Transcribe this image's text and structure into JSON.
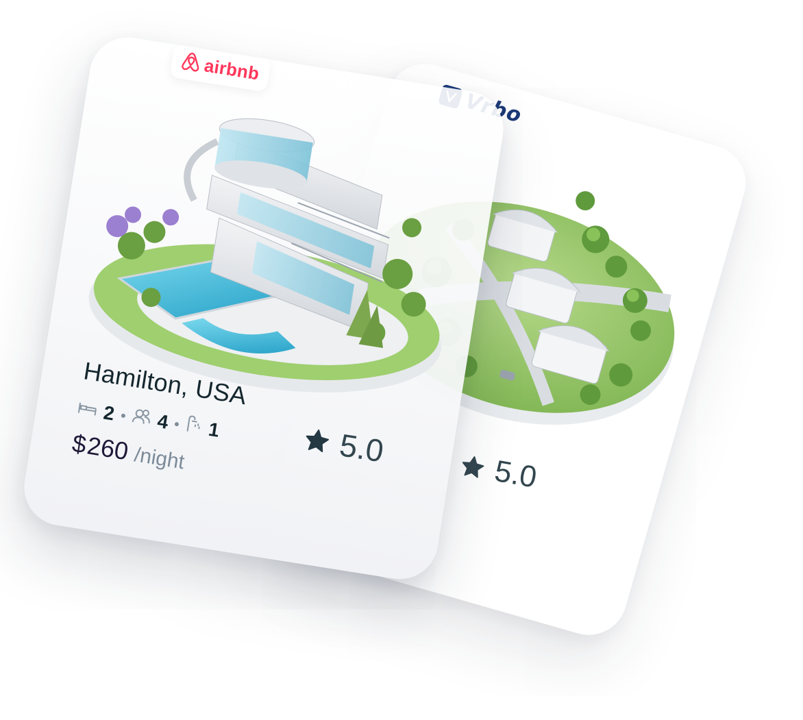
{
  "colors": {
    "airbnb_brand": "#ff385c",
    "vrbo_brand": "#1c3a78",
    "text_dark": "#15272e",
    "text_muted": "#7c8b99",
    "price": "#1f1838",
    "pool": "#3fb6d6",
    "grass": "#8cc260"
  },
  "back_card": {
    "brand": {
      "name": "Vrbo",
      "icon": "vrbo-logo-icon"
    },
    "rating": {
      "icon": "star-icon",
      "value": "5.0"
    }
  },
  "front_card": {
    "brand": {
      "name": "airbnb",
      "icon": "airbnb-logo-icon"
    },
    "title": "Hamilton, USA",
    "amenities": [
      {
        "icon": "bed-icon",
        "value": "2"
      },
      {
        "icon": "guests-icon",
        "value": "4"
      },
      {
        "icon": "bath-icon",
        "value": "1"
      }
    ],
    "price": {
      "currency": "$",
      "value": "260",
      "unit": "/night"
    },
    "rating": {
      "icon": "star-icon",
      "value": "5.0"
    }
  }
}
